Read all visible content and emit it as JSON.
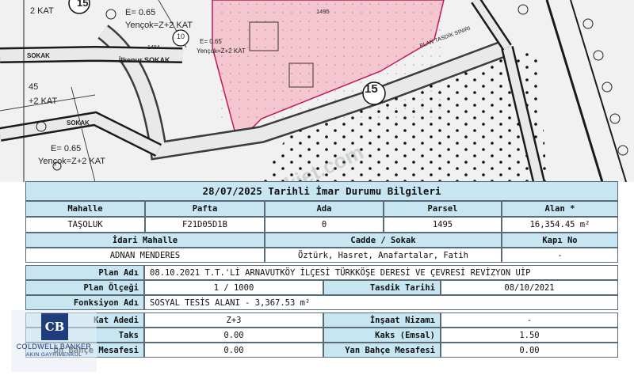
{
  "map": {
    "labels": {
      "zone_a_kat": "2 KAT",
      "zone_a_e": "E= 0.65",
      "zone_a_yencok": "Yençok=Z+2 KAT",
      "zone_b_e": "E= 0.65",
      "zone_b_yencok": "Yençok=Z+2 KAT",
      "zone_c_kat": "+2 KAT",
      "zone_c_45": "45",
      "zone_d_e": "E= 0.65",
      "zone_d_yencok": "Yençok=Z+2 KAT",
      "parcel_1494": "1494",
      "parcel_1495": "1495",
      "sokak_left": "SOKAK",
      "ilkenur_sokak": "İlkenur SOKAK",
      "sokak_lower": "SOKAK",
      "plan_tasdik": "PLAN TASDİK SINIRI",
      "num_15": "15",
      "num_10": "10",
      "num_15b": "15",
      "watermark": "emlakjet.com"
    }
  },
  "info": {
    "title": "28/07/2025 Tarihli İmar Durumu Bilgileri",
    "row1_headers": [
      "Mahalle",
      "Pafta",
      "Ada",
      "Parsel",
      "Alan *"
    ],
    "row1_values": [
      "TAŞOLUK",
      "F21D05D1B",
      "0",
      "1495",
      "16,354.45 m²"
    ],
    "row2_headers": [
      "İdari Mahalle",
      "Cadde / Sokak",
      "Kapı No"
    ],
    "row2_values": [
      "ADNAN MENDERES",
      "Öztürk, Hasret, Anafartalar, Fatih",
      "-"
    ],
    "plan_adi_label": "Plan Adı",
    "plan_adi_value": "08.10.2021 T.T.'Lİ ARNAVUTKÖY İLÇESİ TÜRKKÖŞE DERESİ VE ÇEVRESİ REVİZYON UİP",
    "plan_olcegi_label": "Plan Ölçeği",
    "plan_olcegi_value": "1 / 1000",
    "tasdik_label": "Tasdik Tarihi",
    "tasdik_value": "08/10/2021",
    "fonksiyon_label": "Fonksiyon Adı",
    "fonksiyon_value": "SOSYAL TESİS ALANI - 3,367.53 m²",
    "kat_label": "Kat Adedi",
    "kat_value": "Z+3",
    "insaat_label": "İnşaat Nizamı",
    "insaat_value": "-",
    "taks_label": "Taks",
    "taks_value": "0.00",
    "kaks_label": "Kaks (Emsal)",
    "kaks_value": "1.50",
    "onbahce_label": "Ön Bahçe Mesafesi",
    "onbahce_value": "0.00",
    "yanbahce_label": "Yan Bahçe Mesafesi",
    "yanbahce_value": "0.00"
  },
  "logo": {
    "monogram": "CB",
    "name": "COLDWELL BANKER",
    "subtitle": "AKIN GAYRİMENKUL"
  },
  "colors": {
    "header_bg": "#c7e6f1",
    "parcel_fill": "#f4c6cf",
    "parcel_border": "#c2185b",
    "road": "#1a1a1a",
    "logo_blue": "#1f3d7a"
  }
}
